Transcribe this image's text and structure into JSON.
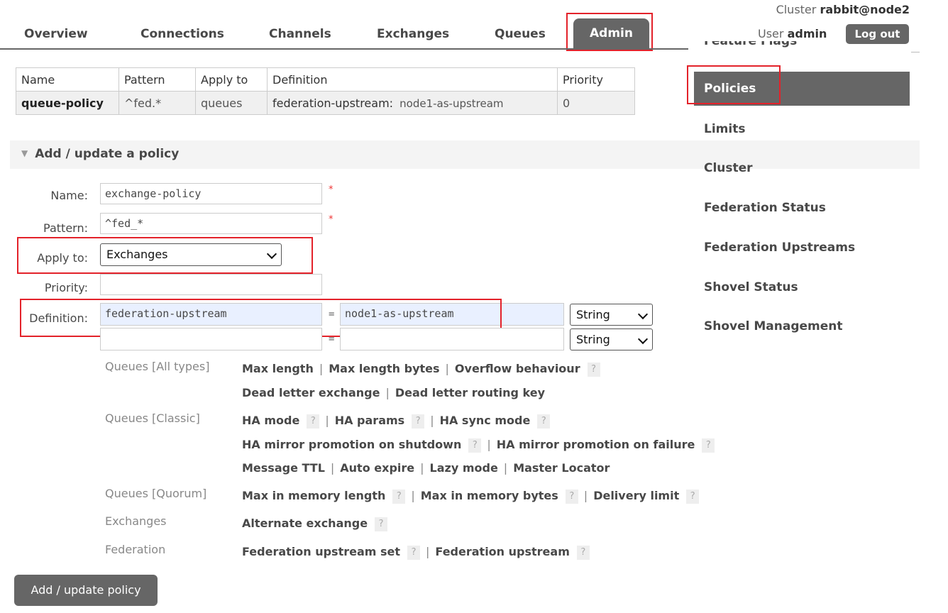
{
  "nav": {
    "tabs": [
      "Overview",
      "Connections",
      "Channels",
      "Exchanges",
      "Queues",
      "Admin"
    ],
    "active": "Admin"
  },
  "header": {
    "cluster_label": "Cluster",
    "cluster_name": "rabbit@node2",
    "user_label": "User",
    "user_name": "admin",
    "logout": "Log out"
  },
  "policies_table": {
    "headers": [
      "Name",
      "Pattern",
      "Apply to",
      "Definition",
      "Priority"
    ],
    "rows": [
      {
        "name": "queue-policy",
        "pattern": "^fed.*",
        "apply_to": "queues",
        "definition_key": "federation-upstream:",
        "definition_value": "node1-as-upstream",
        "priority": "0"
      }
    ]
  },
  "form": {
    "section_title": "Add / update a policy",
    "name_label": "Name:",
    "name_value": "exchange-policy",
    "pattern_label": "Pattern:",
    "pattern_value": "^fed_*",
    "apply_label": "Apply to:",
    "apply_value": "Exchanges",
    "priority_label": "Priority:",
    "priority_value": "",
    "definition_label": "Definition:",
    "def_rows": [
      {
        "key": "federation-upstream",
        "value": "node1-as-upstream",
        "type": "String"
      },
      {
        "key": "",
        "value": "",
        "type": "String"
      }
    ],
    "required_mark": "*",
    "eq": "=",
    "submit": "Add / update policy"
  },
  "help": {
    "categories": [
      {
        "label": "Queues [All types]",
        "lines": [
          [
            {
              "t": "Max length"
            },
            {
              "t": "Max length bytes"
            },
            {
              "t": "Overflow behaviour",
              "q": true
            }
          ],
          [
            {
              "t": "Dead letter exchange"
            },
            {
              "t": "Dead letter routing key"
            }
          ]
        ]
      },
      {
        "label": "Queues [Classic]",
        "lines": [
          [
            {
              "t": "HA mode",
              "q": true
            },
            {
              "t": "HA params",
              "q": true
            },
            {
              "t": "HA sync mode",
              "q": true
            }
          ],
          [
            {
              "t": "HA mirror promotion on shutdown",
              "q": true
            },
            {
              "t": "HA mirror promotion on failure",
              "q": true
            }
          ],
          [
            {
              "t": "Message TTL"
            },
            {
              "t": "Auto expire"
            },
            {
              "t": "Lazy mode"
            },
            {
              "t": "Master Locator"
            }
          ]
        ]
      },
      {
        "label": "Queues [Quorum]",
        "lines": [
          [
            {
              "t": "Max in memory length",
              "q": true
            },
            {
              "t": "Max in memory bytes",
              "q": true
            },
            {
              "t": "Delivery limit",
              "q": true
            }
          ]
        ]
      },
      {
        "label": "Exchanges",
        "lines": [
          [
            {
              "t": "Alternate exchange",
              "q": true
            }
          ]
        ]
      },
      {
        "label": "Federation",
        "lines": [
          [
            {
              "t": "Federation upstream set",
              "q": true
            },
            {
              "t": "Federation upstream",
              "q": true
            }
          ]
        ]
      }
    ],
    "q_mark": "?",
    "sep": "|"
  },
  "sidebar": {
    "cut_item": "Feature Flags",
    "items": [
      "Policies",
      "Limits",
      "Cluster",
      "Federation Status",
      "Federation Upstreams",
      "Shovel Status",
      "Shovel Management"
    ],
    "active": "Policies"
  },
  "colors": {
    "tab_bg": "#666666",
    "highlight": "#e3222a",
    "input_highlight": "#e9f0ff"
  }
}
